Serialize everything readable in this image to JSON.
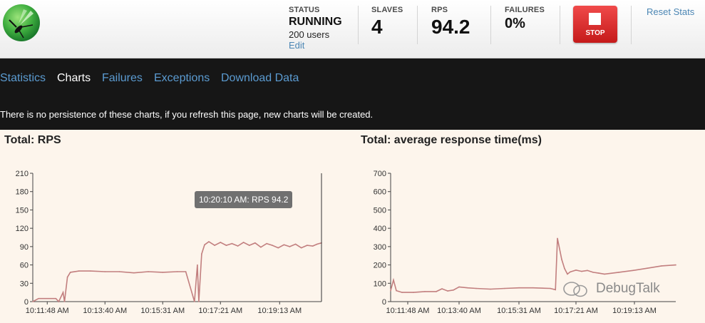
{
  "header": {
    "status": {
      "label": "STATUS",
      "value": "RUNNING",
      "users": "200 users",
      "edit": "Edit"
    },
    "slaves": {
      "label": "SLAVES",
      "value": "4"
    },
    "rps": {
      "label": "RPS",
      "value": "94.2"
    },
    "failures": {
      "label": "FAILURES",
      "value": "0%"
    },
    "stop_label": "STOP",
    "reset_label": "Reset Stats"
  },
  "nav": {
    "tabs": [
      "Statistics",
      "Charts",
      "Failures",
      "Exceptions",
      "Download Data"
    ],
    "active": "Charts",
    "note": "There is no persistence of these charts, if you refresh this page, new charts will be created."
  },
  "tooltip": "10:20:10 AM: RPS 94.2",
  "watermark": "DebugTalk",
  "chart_data": [
    {
      "type": "line",
      "title": "Total: RPS",
      "ylim": [
        0,
        210
      ],
      "yticks": [
        0,
        30,
        60,
        90,
        120,
        150,
        180,
        210
      ],
      "xticks": [
        "10:11:48 AM",
        "10:13:40 AM",
        "10:15:31 AM",
        "10:17:21 AM",
        "10:19:13 AM"
      ],
      "xtick_pos": [
        0.05,
        0.25,
        0.45,
        0.65,
        0.855
      ],
      "line_color": "#c27f7f",
      "points": [
        [
          0.0,
          0
        ],
        [
          0.02,
          5
        ],
        [
          0.08,
          5
        ],
        [
          0.09,
          0
        ],
        [
          0.105,
          15
        ],
        [
          0.11,
          0
        ],
        [
          0.12,
          40
        ],
        [
          0.13,
          48
        ],
        [
          0.16,
          50
        ],
        [
          0.2,
          50
        ],
        [
          0.25,
          49
        ],
        [
          0.3,
          49
        ],
        [
          0.35,
          47
        ],
        [
          0.4,
          49
        ],
        [
          0.45,
          48
        ],
        [
          0.5,
          49
        ],
        [
          0.53,
          49
        ],
        [
          0.56,
          0
        ],
        [
          0.57,
          60
        ],
        [
          0.575,
          0
        ],
        [
          0.585,
          78
        ],
        [
          0.595,
          93
        ],
        [
          0.61,
          98
        ],
        [
          0.63,
          92
        ],
        [
          0.65,
          97
        ],
        [
          0.67,
          92
        ],
        [
          0.69,
          95
        ],
        [
          0.71,
          91
        ],
        [
          0.73,
          97
        ],
        [
          0.75,
          92
        ],
        [
          0.77,
          96
        ],
        [
          0.79,
          89
        ],
        [
          0.81,
          95
        ],
        [
          0.83,
          92
        ],
        [
          0.85,
          88
        ],
        [
          0.87,
          93
        ],
        [
          0.89,
          90
        ],
        [
          0.91,
          94
        ],
        [
          0.93,
          88
        ],
        [
          0.95,
          92
        ],
        [
          0.97,
          91
        ],
        [
          0.985,
          94
        ],
        [
          1.0,
          96
        ]
      ]
    },
    {
      "type": "line",
      "title": "Total: average response time(ms)",
      "ylim": [
        0,
        700
      ],
      "yticks": [
        0,
        100,
        200,
        300,
        400,
        500,
        600,
        700
      ],
      "xticks": [
        "10:11:48 AM",
        "10:13:40 AM",
        "10:15:31 AM",
        "10:17:21 AM",
        "10:19:13 AM"
      ],
      "xtick_pos": [
        0.06,
        0.24,
        0.45,
        0.65,
        0.855
      ],
      "line_color": "#c27f7f",
      "points": [
        [
          0.0,
          60
        ],
        [
          0.01,
          118
        ],
        [
          0.02,
          60
        ],
        [
          0.04,
          50
        ],
        [
          0.08,
          50
        ],
        [
          0.12,
          55
        ],
        [
          0.16,
          55
        ],
        [
          0.18,
          70
        ],
        [
          0.2,
          58
        ],
        [
          0.22,
          63
        ],
        [
          0.24,
          80
        ],
        [
          0.27,
          75
        ],
        [
          0.3,
          72
        ],
        [
          0.35,
          68
        ],
        [
          0.4,
          72
        ],
        [
          0.45,
          75
        ],
        [
          0.5,
          75
        ],
        [
          0.56,
          72
        ],
        [
          0.578,
          65
        ],
        [
          0.585,
          345
        ],
        [
          0.6,
          230
        ],
        [
          0.61,
          180
        ],
        [
          0.62,
          150
        ],
        [
          0.63,
          162
        ],
        [
          0.65,
          172
        ],
        [
          0.67,
          165
        ],
        [
          0.69,
          170
        ],
        [
          0.71,
          160
        ],
        [
          0.73,
          155
        ],
        [
          0.75,
          150
        ],
        [
          0.8,
          160
        ],
        [
          0.85,
          170
        ],
        [
          0.9,
          182
        ],
        [
          0.95,
          195
        ],
        [
          1.0,
          200
        ]
      ]
    }
  ]
}
